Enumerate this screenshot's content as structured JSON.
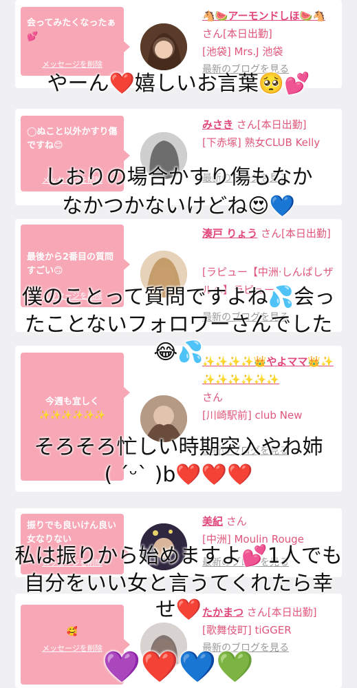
{
  "cards": [
    {
      "message": "会ってみたくなったぁ💕",
      "delete_label": "メッセージを削除",
      "name": "🐴🍉アーモンドしほ🍉🐴",
      "suffix": "さん[本日出勤]",
      "shop": "[池袋] Mrs.J 池袋",
      "blog_label": "最新のブログを見る"
    },
    {
      "message": "◯ぬこと以外かすり傷ですね😊",
      "delete_label": "メッセージを削除",
      "name": "みさき",
      "suffix": "さん[本日出勤]",
      "shop": "[下赤塚] 熟女CLUB Kelly",
      "blog_label": "最新のブログを見る"
    },
    {
      "message": "最後から2番目の質問すごい🙃",
      "delete_label": "メッセージを削除",
      "name": "湊戸 りょう",
      "suffix": "さん[本日出勤]",
      "shop": "[ラピュー【中洲·しんぱしザルへ】ラピュー",
      "blog_label": "最新のブログを見る"
    },
    {
      "message": "今週も宜しく✨✨✨✨✨✨",
      "delete_label": "",
      "name": "✨✨✨✨👑やよママ👑✨✨✨✨✨✨✨",
      "suffix": "さん",
      "shop": "[川崎駅前] club New",
      "blog_label": "最新のブログを見る"
    },
    {
      "message": "振りでも良いけん良い女なりない",
      "delete_label": "メッセージを削除",
      "name": "美紀",
      "suffix": "さん",
      "shop": "[中洲] Moulin Rouge",
      "blog_label": "最新のブログを見る"
    },
    {
      "message": "🥰",
      "delete_label": "メッセージを削除",
      "name": "たかまつ",
      "suffix": "さん[本日出勤]",
      "shop": "[歌舞伎町] tiGGER",
      "blog_label": "最新のブログを見る"
    }
  ],
  "overlays": [
    "やーん❤️嬉しいお言葉🥺💕",
    "しおりの場合かすり傷もなか",
    "なかつかないけどね😍💙",
    "僕のことって質問ですよね💦会っ",
    "たことないフォロワーさんでした",
    "😂💦",
    "そろそろ忙しい時期突入やね姉",
    "( ´ᵕ` )b❤️❤️❤️",
    "私は振りから始めますよ💕1人でも",
    "自分をいい女と言うてくれたら幸",
    "せ❤️",
    "💜❤️💙💚"
  ],
  "colors": {
    "bubble": "#f7a7b5",
    "accent": "#e0467a",
    "background": "#f0f0f2"
  }
}
